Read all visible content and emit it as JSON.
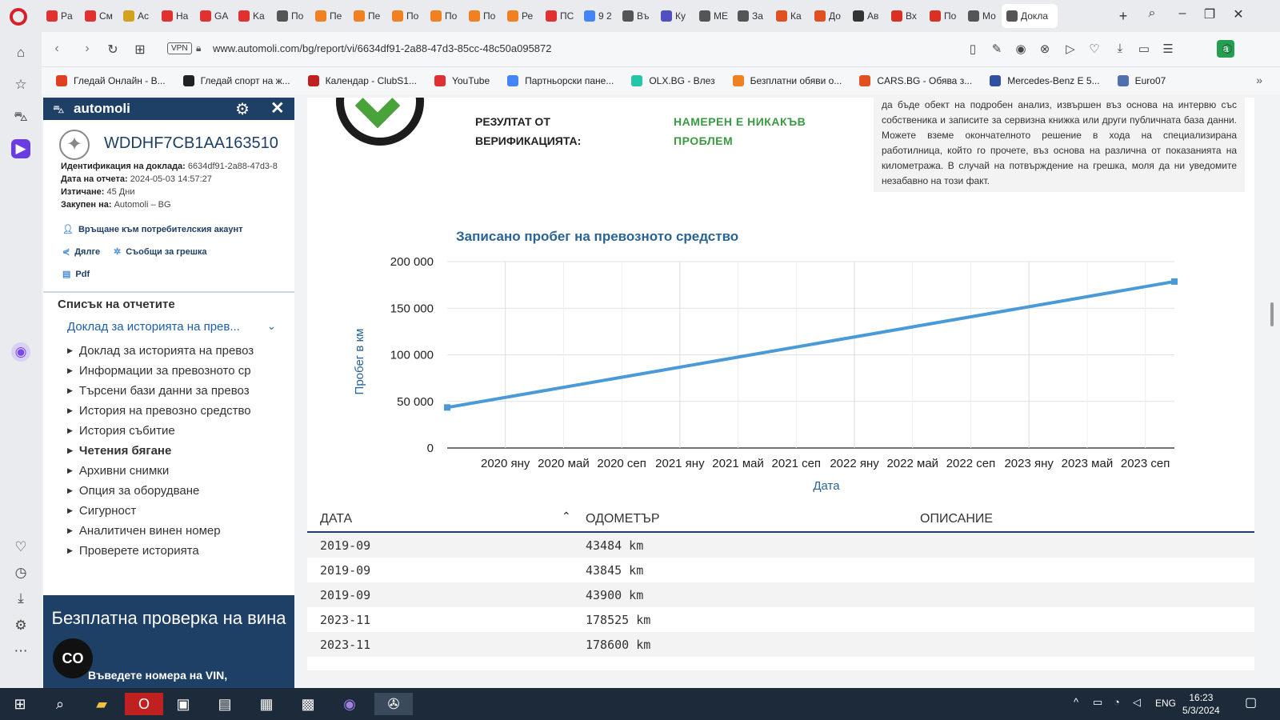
{
  "browser": {
    "tabs": [
      {
        "label": "Pa",
        "color": "#e03030"
      },
      {
        "label": "См",
        "color": "#e03030"
      },
      {
        "label": "Ac",
        "color": "#d4a020"
      },
      {
        "label": "Ha",
        "color": "#e03030"
      },
      {
        "label": "GA",
        "color": "#e03030"
      },
      {
        "label": "Ka",
        "color": "#e03030"
      },
      {
        "label": "По",
        "color": "#555555"
      },
      {
        "label": "Пе",
        "color": "#f08020"
      },
      {
        "label": "Пе",
        "color": "#f08020"
      },
      {
        "label": "По",
        "color": "#f08020"
      },
      {
        "label": "По",
        "color": "#f08020"
      },
      {
        "label": "По",
        "color": "#f08020"
      },
      {
        "label": "Ре",
        "color": "#f08020"
      },
      {
        "label": "ПС",
        "color": "#e03030"
      },
      {
        "label": "9 2",
        "color": "#4285f4"
      },
      {
        "label": "Въ",
        "color": "#555555"
      },
      {
        "label": "Ку",
        "color": "#5050c0"
      },
      {
        "label": "МЕ",
        "color": "#555555"
      },
      {
        "label": "За",
        "color": "#555555"
      },
      {
        "label": "Ка",
        "color": "#e05020"
      },
      {
        "label": "До",
        "color": "#e05020"
      },
      {
        "label": "Ав",
        "color": "#333333"
      },
      {
        "label": "Вх",
        "color": "#d93025"
      },
      {
        "label": "По",
        "color": "#d93025"
      },
      {
        "label": "Мо",
        "color": "#555555"
      }
    ],
    "active_tab": "Докла",
    "url": "www.automoli.com/bg/report/vi/6634df91-2a88-47d3-85cc-48c50a095872",
    "vpn": "VPN",
    "profile_letter": "a",
    "bookmarks": [
      {
        "label": "Гледай Онлайн - В...",
        "color": "#e04020"
      },
      {
        "label": "Гледай спорт на ж...",
        "color": "#222222"
      },
      {
        "label": "Календар - ClubS1...",
        "color": "#c02020"
      },
      {
        "label": "YouTube",
        "color": "#e03030"
      },
      {
        "label": "Партньорски пане...",
        "color": "#4285f4"
      },
      {
        "label": "OLX.BG - Влез",
        "color": "#23c6a8"
      },
      {
        "label": "Безплатни обяви о...",
        "color": "#f08020"
      },
      {
        "label": "CARS.BG - Обява з...",
        "color": "#e05020"
      },
      {
        "label": "Mercedes-Benz E 5...",
        "color": "#3050a0"
      },
      {
        "label": "Euro07",
        "color": "#5070b0"
      }
    ]
  },
  "panel": {
    "logo": "automoli",
    "vin": "WDDHF7CB1AA163510",
    "meta": [
      {
        "label": "Идентификация на доклада:",
        "value": "6634df91-2a88-47d3-8"
      },
      {
        "label": "Дата на отчета:",
        "value": "2024-05-03 14:57:27"
      },
      {
        "label": "Изтичане:",
        "value": "45 Дни"
      },
      {
        "label": "Закупен на:",
        "value": "Automoli – BG"
      }
    ],
    "back_link": "Връщане към потребителския акаунт",
    "share": "Дялге",
    "report_error": "Съобщи за грешка",
    "pdf": "Pdf",
    "list_title": "Списък на отчетите",
    "selected_report": "Доклад за историята на прев...",
    "report_items": [
      "Доклад за историята на превоз",
      "Информации за превозното ср",
      "Търсени бази данни за превоз",
      "История на превозно средство",
      "История събитие",
      "Четения бягане",
      "Архивни снимки",
      "Опция за оборудване",
      "Сигурност",
      "Аналитичен винен номер",
      "Проверете историята"
    ],
    "bold_item_index": 5,
    "promo_title": "Безплатна проверка на вина",
    "promo_sub": "Въведете номера на VIN,",
    "promo_badge": "CO"
  },
  "verification": {
    "label_line1": "РЕЗУЛТАТ ОТ",
    "label_line2": "ВЕРИФИКАЦИЯТА:",
    "result_line1": "НАМЕРЕН Е НИКАКЪВ",
    "result_line2": "ПРОБЛЕМ",
    "note": "да бъде обект на подробен анализ, извършен въз основа на интервю със собственика и записите за сервизна книжка или други публичната база данни. Можете вземе окончателното решение в хода на специализирана работилница, който го прочете, въз основа на различна от показанията на километража. В случай на потвърждение на грешка, моля да ни уведомите незабавно на този факт."
  },
  "chart_data": {
    "type": "line",
    "title": "Записано пробег на превозното средство",
    "xlabel": "Дата",
    "ylabel": "Пробег в км",
    "x_ticks": [
      "2020 яну",
      "2020 май",
      "2020 сеп",
      "2021 яну",
      "2021 май",
      "2021 сеп",
      "2022 яну",
      "2022 май",
      "2022 сеп",
      "2023 яну",
      "2023 май",
      "2023 сеп"
    ],
    "y_ticks": [
      "0",
      "50 000",
      "100 000",
      "150 000",
      "200 000"
    ],
    "ylim": [
      0,
      200000
    ],
    "xlim": [
      "2019-09",
      "2023-11"
    ],
    "grid": true,
    "series": [
      {
        "points": [
          {
            "x": "2019-09",
            "y": 43484
          },
          {
            "x": "2023-11",
            "y": 178600
          }
        ],
        "color": "#4a9ad8"
      }
    ]
  },
  "table": {
    "headers": {
      "date": "ДАТА",
      "odometer": "ОДОМЕТЪР",
      "description": "ОПИСАНИЕ"
    },
    "rows": [
      {
        "date": "2019-09",
        "odometer": "43484 km"
      },
      {
        "date": "2019-09",
        "odometer": "43845 km"
      },
      {
        "date": "2019-09",
        "odometer": "43900 km"
      },
      {
        "date": "2023-11",
        "odometer": "178525 km"
      },
      {
        "date": "2023-11",
        "odometer": "178600 km"
      }
    ]
  },
  "taskbar": {
    "lang": "ENG",
    "time": "16:23",
    "date": "5/3/2024"
  }
}
